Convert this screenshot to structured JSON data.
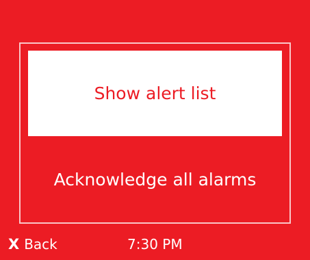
{
  "colors": {
    "background": "#ec1c24",
    "selected_bg": "#ffffff",
    "text": "#ffffff",
    "selected_text": "#ec1c24"
  },
  "menu": {
    "items": [
      {
        "label": "Show alert list",
        "selected": true
      },
      {
        "label": "Acknowledge all alarms",
        "selected": false
      }
    ]
  },
  "footer": {
    "back_glyph": "X",
    "back_label": "Back",
    "time": "7:30 PM"
  }
}
